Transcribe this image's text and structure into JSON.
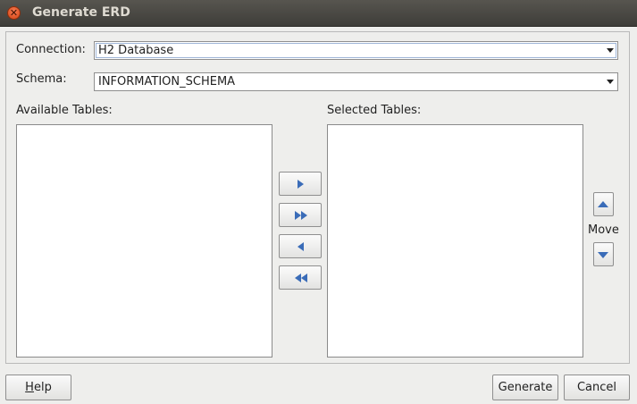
{
  "window": {
    "title": "Generate ERD"
  },
  "connection": {
    "label": "Connection:",
    "value": "H2 Database"
  },
  "schema": {
    "label": "Schema:",
    "value": "INFORMATION_SCHEMA"
  },
  "available": {
    "label": "Available Tables:",
    "items": []
  },
  "selected": {
    "label": "Selected Tables:",
    "items": []
  },
  "move": {
    "label": "Move"
  },
  "buttons": {
    "help_mnemonic": "H",
    "help_rest": "elp",
    "generate": "Generate",
    "cancel": "Cancel"
  },
  "icons": {
    "close": "close-icon",
    "add": "arrow-right-icon",
    "add_all": "double-arrow-right-icon",
    "remove": "arrow-left-icon",
    "remove_all": "double-arrow-left-icon",
    "move_up": "arrow-up-icon",
    "move_down": "arrow-down-icon"
  },
  "colors": {
    "accent": "#3a6cb8",
    "close": "#e5572a",
    "titlebar": "#3e3d39"
  }
}
